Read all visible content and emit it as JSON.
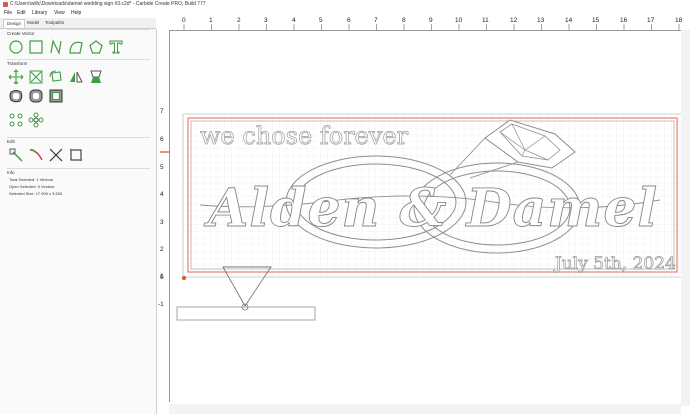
{
  "window": {
    "title": "C:\\Users\\willc\\Downloads\\damiel wedding sign #3.c2d* - Carbide Create PRO, Build 777"
  },
  "menu": [
    "File",
    "Edit",
    "Library",
    "View",
    "Help"
  ],
  "tabs": [
    "Design",
    "Model",
    "Toolpaths"
  ],
  "panel": {
    "create_vector": "Create Vector",
    "transform": "Transform",
    "edit": "Edit",
    "info": "Info",
    "info_rows": [
      {
        "label": "Total Selected:",
        "value": "1 Vectors"
      },
      {
        "label": "Open Selected:",
        "value": "0 Vectors"
      },
      {
        "label": "Selected Size:",
        "value": "17.900 x 3.600"
      }
    ]
  },
  "rulers": {
    "h_labels": [
      "0",
      "1",
      "2",
      "3",
      "4",
      "5",
      "6",
      "7",
      "8",
      "9",
      "10",
      "11",
      "12",
      "13",
      "14",
      "15",
      "16",
      "17",
      "18"
    ],
    "v_labels": [
      "7",
      "6",
      "5",
      "4",
      "3",
      "2",
      "1",
      "0",
      "-1"
    ]
  },
  "design": {
    "tagline": "we chose forever",
    "names": "Alden & Damel",
    "date": "July 5th, 2024"
  },
  "colors": {
    "accent_green": "#3d9f3d",
    "red_border": "#e35a3a",
    "grid": "#e4e4e4",
    "vector": "#8e8e8e"
  }
}
